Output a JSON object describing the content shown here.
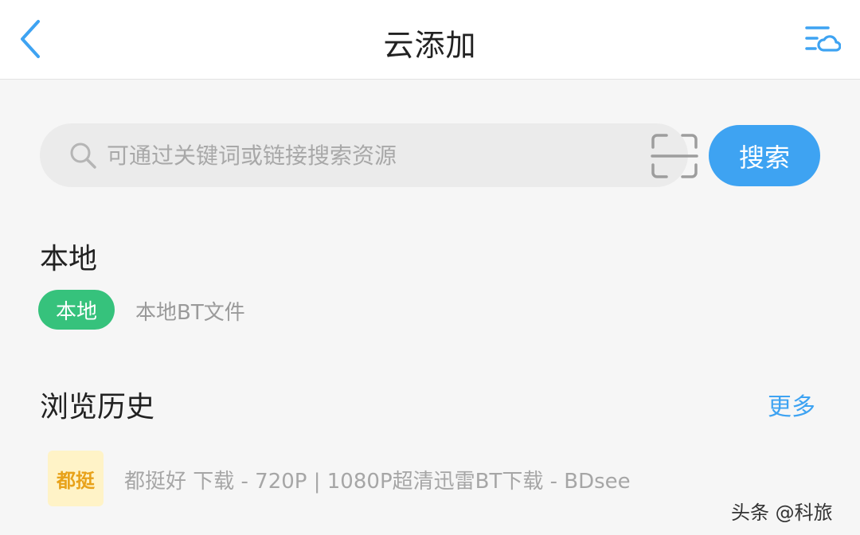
{
  "header": {
    "title": "云添加",
    "back_icon": "chevron-left-icon",
    "task_icon": "cloud-list-icon",
    "accent": "#3ea3f2"
  },
  "search": {
    "placeholder": "可通过关键词或链接搜索资源",
    "value": "",
    "button_label": "搜索",
    "button_color": "#3ea3f2",
    "scan_icon": "scan-frame-icon"
  },
  "local": {
    "section_title": "本地",
    "badge_label": "本地",
    "badge_color": "#36c27c",
    "link_label": "本地BT文件"
  },
  "history": {
    "section_title": "浏览历史",
    "more_label": "更多",
    "items": [
      {
        "icon_text": "都挺",
        "title": "都挺好 下载 - 720P | 1080P超清迅雷BT下载 - BDsee"
      }
    ]
  },
  "watermark": "头条 @科旅"
}
